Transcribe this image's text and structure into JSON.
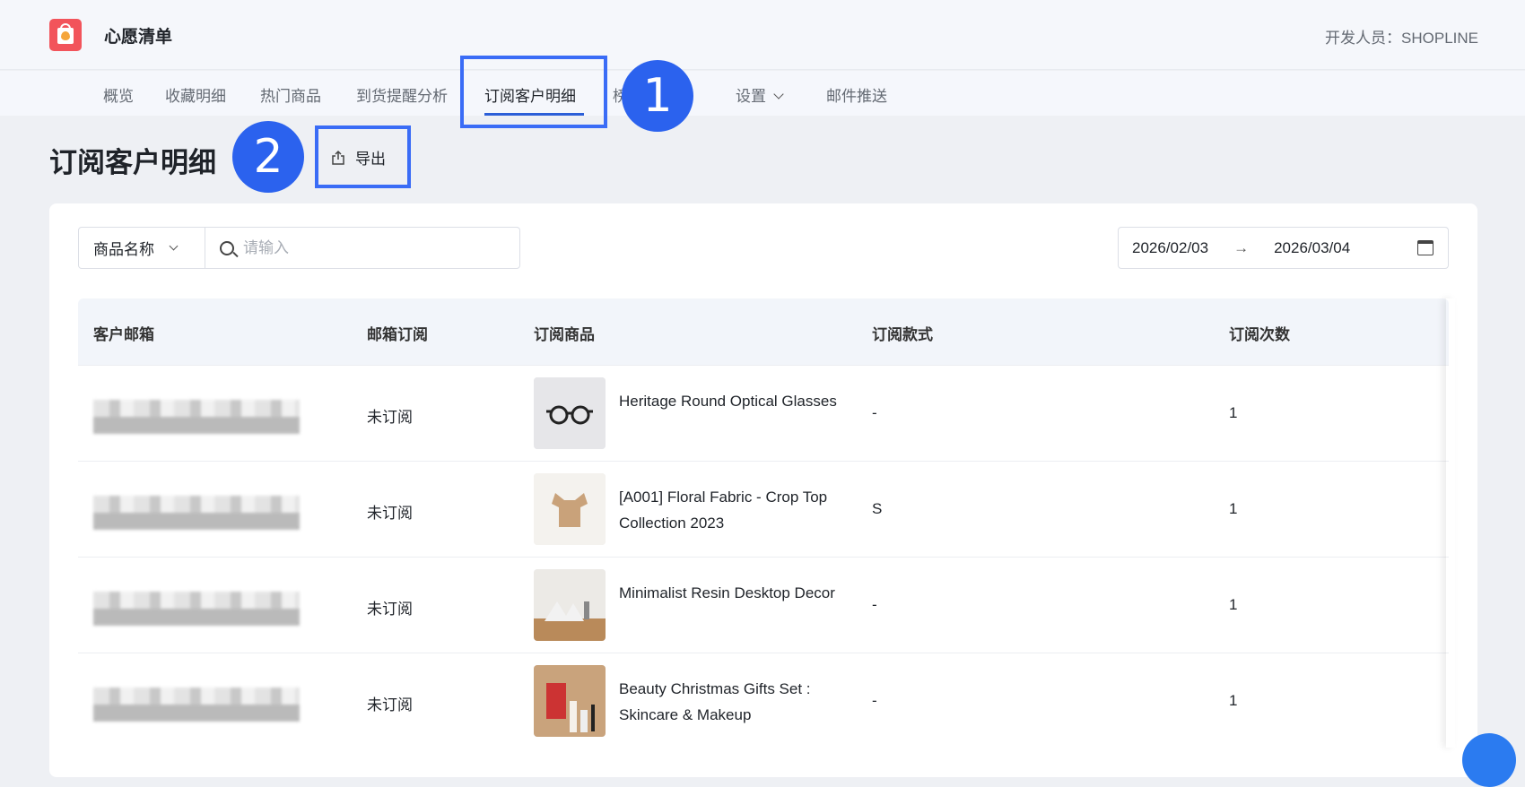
{
  "header": {
    "app_title": "心愿清单",
    "developer": "开发人员：SHOPLINE"
  },
  "nav": {
    "items": [
      {
        "label": "概览"
      },
      {
        "label": "收藏明细"
      },
      {
        "label": "热门商品"
      },
      {
        "label": "到货提醒分析"
      },
      {
        "label": "订阅客户明细",
        "active": true
      },
      {
        "label": "榜单"
      },
      {
        "label": "设置"
      },
      {
        "label": "邮件推送"
      }
    ]
  },
  "annotations": {
    "step1": "1",
    "step2": "2"
  },
  "page": {
    "title": "订阅客户明细",
    "export_label": "导出"
  },
  "filters": {
    "field_select": "商品名称",
    "search_placeholder": "请输入",
    "date_start": "2026/02/03",
    "date_end": "2026/03/04",
    "date_separator": "→"
  },
  "table": {
    "columns": [
      "客户邮箱",
      "邮箱订阅",
      "订阅商品",
      "订阅款式",
      "订阅次数"
    ],
    "rows": [
      {
        "subscription": "未订阅",
        "product": "Heritage Round Optical Glasses",
        "variant": "-",
        "count": "1"
      },
      {
        "subscription": "未订阅",
        "product": "[A001] Floral Fabric - Crop Top Collection 2023",
        "variant": "S",
        "count": "1"
      },
      {
        "subscription": "未订阅",
        "product": "Minimalist Resin Desktop Decor",
        "variant": "-",
        "count": "1"
      },
      {
        "subscription": "未订阅",
        "product": "Beauty Christmas Gifts Set : Skincare & Makeup",
        "variant": "-",
        "count": "1"
      }
    ]
  },
  "colors": {
    "accent": "#2c5fd8",
    "annotation": "#3a6cf6",
    "logo": "#f2545b"
  }
}
